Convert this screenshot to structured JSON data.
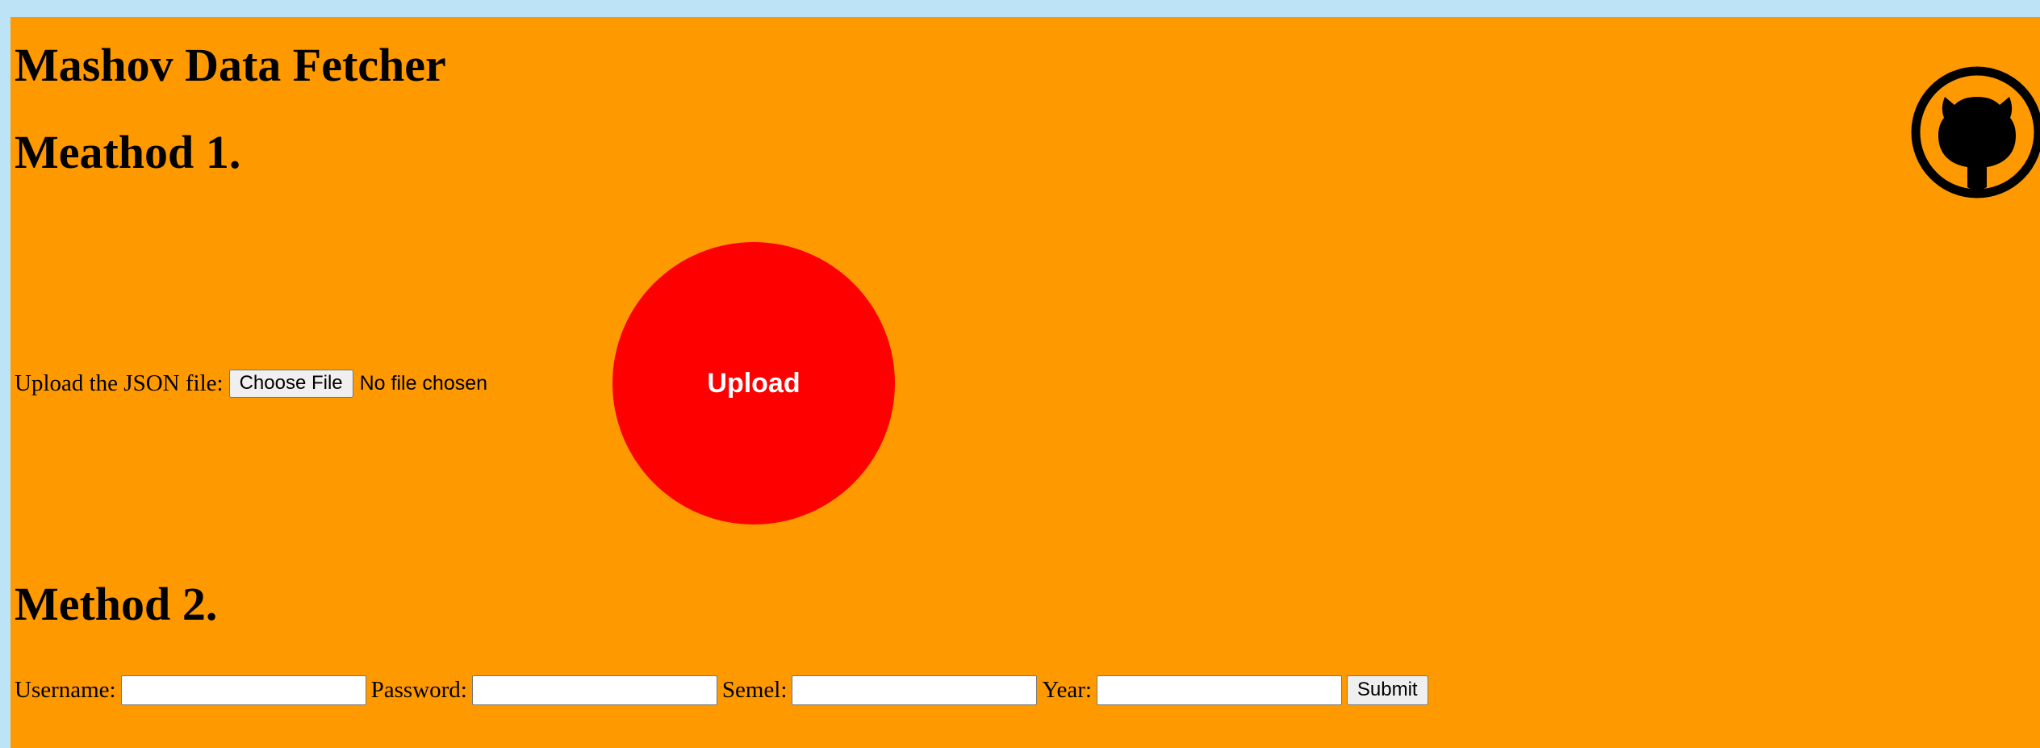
{
  "page": {
    "title": "Mashov Data Fetcher"
  },
  "method1": {
    "heading": "Meathod 1.",
    "upload_label": "Upload the JSON file:",
    "choose_file_label": "Choose File",
    "file_status": "No file chosen",
    "upload_button_label": "Upload"
  },
  "method2": {
    "heading": "Method 2.",
    "username_label": "Username:",
    "password_label": "Password:",
    "semel_label": "Semel:",
    "year_label": "Year:",
    "username_value": "",
    "password_value": "",
    "semel_value": "",
    "year_value": "",
    "submit_label": "Submit"
  },
  "icons": {
    "github": "github-icon"
  },
  "colors": {
    "page_bg": "#bde3f7",
    "panel_bg": "#ff9900",
    "upload_circle": "#ff0000",
    "upload_text": "#ffffff"
  }
}
